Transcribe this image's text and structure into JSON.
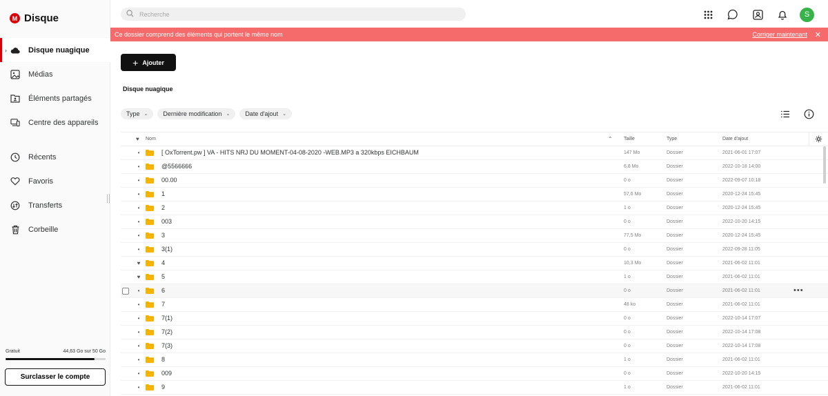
{
  "app": {
    "name": "Disque",
    "logo_letter": "M"
  },
  "search": {
    "placeholder": "Recherche"
  },
  "sidebar": {
    "items": [
      {
        "label": "Disque nuagique",
        "icon": "cloud-icon",
        "active": true
      },
      {
        "label": "Médias",
        "icon": "image-icon"
      },
      {
        "label": "Éléments partagés",
        "icon": "shared-folder-icon"
      },
      {
        "label": "Centre des appareils",
        "icon": "devices-icon"
      },
      {
        "label": "Récents",
        "icon": "clock-icon"
      },
      {
        "label": "Favoris",
        "icon": "heart-icon"
      },
      {
        "label": "Transferts",
        "icon": "transfer-icon"
      },
      {
        "label": "Corbeille",
        "icon": "trash-icon"
      }
    ],
    "storage": {
      "plan": "Gratuit",
      "usage": "44,63 Go sur 50 Go",
      "fraction": 0.8926
    },
    "upgrade_label": "Surclasser le compte"
  },
  "topbar": {
    "avatar_letter": "S",
    "avatar_color": "#37b34a"
  },
  "banner": {
    "message": "Ce dossier comprend des éléments qui portent le même nom",
    "action": "Corriger maintenant",
    "close": "✕",
    "color": "#f56b6b"
  },
  "main": {
    "add_label": "Ajouter",
    "title": "Disque nuagique",
    "filters": [
      "Type",
      "Dernière modification",
      "Date d'ajout"
    ]
  },
  "table": {
    "headers": {
      "name": "Nom",
      "size": "Taille",
      "type": "Type",
      "date": "Date d'ajout"
    },
    "rows": [
      {
        "name": "[ OxTorrent.pw ] VA - HITS NRJ DU MOMENT-04-08-2020 -WEB.MP3 a 320kbps EICHBAUM",
        "size": "147 Mo",
        "type": "Dossier",
        "date": "2021-06-01 17:07",
        "fav": false
      },
      {
        "name": "@5566666",
        "size": "6,8 Mo",
        "type": "Dossier",
        "date": "2022-10-18 14:00",
        "fav": false
      },
      {
        "name": "00.00",
        "size": "0 o",
        "type": "Dossier",
        "date": "2022-09-07 10:18",
        "fav": false
      },
      {
        "name": "1",
        "size": "57,6 Mo",
        "type": "Dossier",
        "date": "2020-12-24 15:45",
        "fav": false
      },
      {
        "name": "2",
        "size": "1 o",
        "type": "Dossier",
        "date": "2020-12-24 15:45",
        "fav": false
      },
      {
        "name": "003",
        "size": "0 o",
        "type": "Dossier",
        "date": "2022-10-20 14:15",
        "fav": false
      },
      {
        "name": "3",
        "size": "77,5 Mo",
        "type": "Dossier",
        "date": "2020-12-24 15:45",
        "fav": false
      },
      {
        "name": "3(1)",
        "size": "0 o",
        "type": "Dossier",
        "date": "2022-09-28 11:05",
        "fav": false
      },
      {
        "name": "4",
        "size": "10,3 Mo",
        "type": "Dossier",
        "date": "2021-06-02 11:01",
        "fav": true
      },
      {
        "name": "5",
        "size": "1 o",
        "type": "Dossier",
        "date": "2021-06-02 11:01",
        "fav": true
      },
      {
        "name": "6",
        "size": "0 o",
        "type": "Dossier",
        "date": "2021-06-02 11:01",
        "fav": false,
        "hover": true
      },
      {
        "name": "7",
        "size": "48 ko",
        "type": "Dossier",
        "date": "2021-06-02 11:01",
        "fav": false
      },
      {
        "name": "7(1)",
        "size": "0 o",
        "type": "Dossier",
        "date": "2022-10-14 17:07",
        "fav": false
      },
      {
        "name": "7(2)",
        "size": "0 o",
        "type": "Dossier",
        "date": "2022-10-14 17:08",
        "fav": false
      },
      {
        "name": "7(3)",
        "size": "0 o",
        "type": "Dossier",
        "date": "2022-10-14 17:08",
        "fav": false
      },
      {
        "name": "8",
        "size": "1 o",
        "type": "Dossier",
        "date": "2021-06-02 11:01",
        "fav": false
      },
      {
        "name": "009",
        "size": "0 o",
        "type": "Dossier",
        "date": "2022-10-20 14:15",
        "fav": false
      },
      {
        "name": "9",
        "size": "1 o",
        "type": "Dossier",
        "date": "2021-06-02 11:01",
        "fav": false
      }
    ]
  },
  "colors": {
    "accent": "#d90007",
    "folder": "#f7b500"
  }
}
